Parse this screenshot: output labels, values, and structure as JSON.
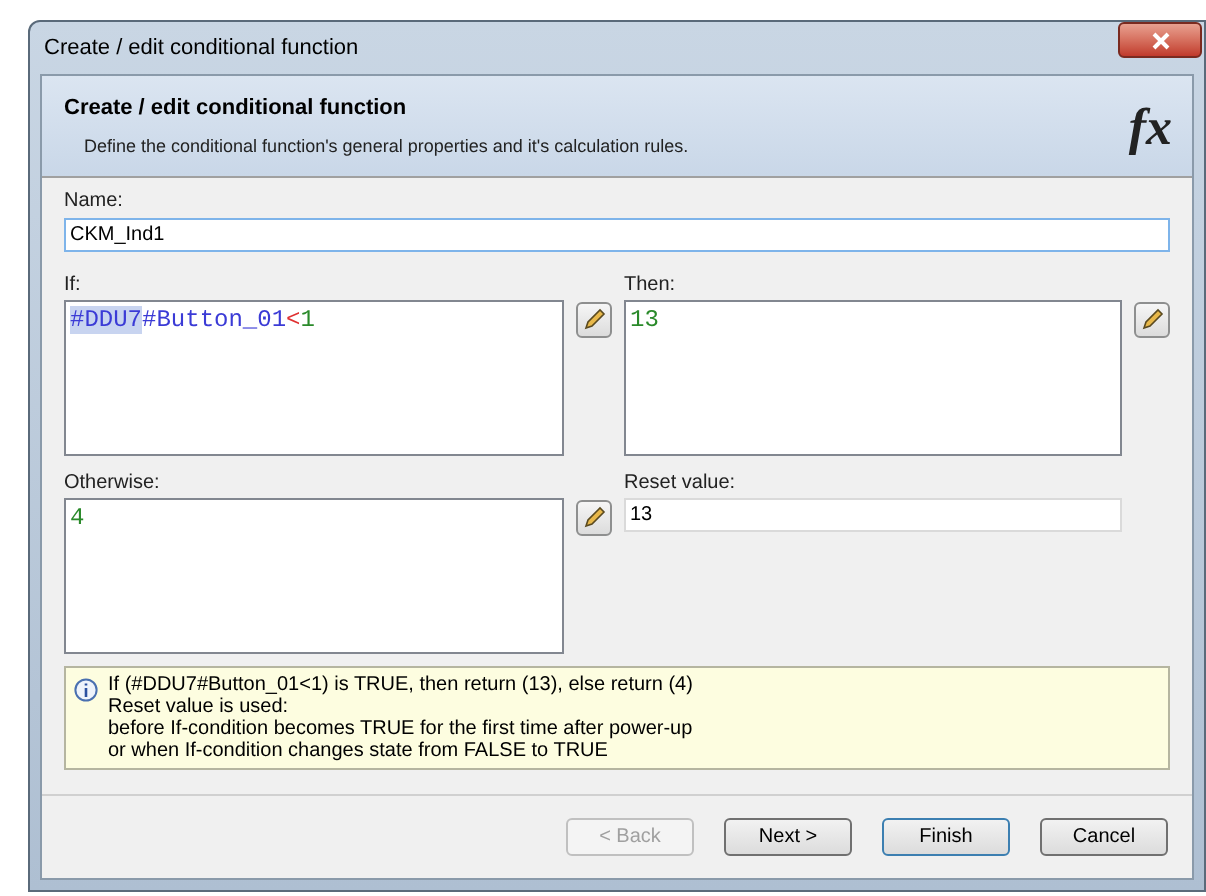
{
  "window": {
    "title": "Create / edit conditional function"
  },
  "header": {
    "title": "Create / edit conditional function",
    "subtitle": "Define the conditional function's general properties and it's calculation rules.",
    "logo": "fx"
  },
  "name_field": {
    "label": "Name:",
    "value": "CKM_Ind1"
  },
  "if_field": {
    "label": "If:",
    "tokens": [
      {
        "text": "#DDU7",
        "kind": "variable",
        "selected": true
      },
      {
        "text": "#Button_01",
        "kind": "variable",
        "selected": false
      },
      {
        "text": "<",
        "kind": "operator",
        "selected": false
      },
      {
        "text": "1",
        "kind": "number",
        "selected": false
      }
    ]
  },
  "then_field": {
    "label": "Then:",
    "tokens": [
      {
        "text": "13",
        "kind": "number",
        "selected": false
      }
    ]
  },
  "otherwise_field": {
    "label": "Otherwise:",
    "tokens": [
      {
        "text": "4",
        "kind": "number",
        "selected": false
      }
    ]
  },
  "reset_field": {
    "label": "Reset value:",
    "value": "13"
  },
  "info": [
    "If (#DDU7#Button_01<1) is TRUE, then return (13), else return (4)",
    "Reset value is used:",
    "before If-condition becomes TRUE for the first time after power-up",
    "or when If-condition changes state from FALSE to TRUE"
  ],
  "buttons": [
    {
      "label": "< Back",
      "disabled": true,
      "default": false
    },
    {
      "label": "Next >",
      "disabled": false,
      "default": false
    },
    {
      "label": "Finish",
      "disabled": false,
      "default": true
    },
    {
      "label": "Cancel",
      "disabled": false,
      "default": false
    }
  ]
}
